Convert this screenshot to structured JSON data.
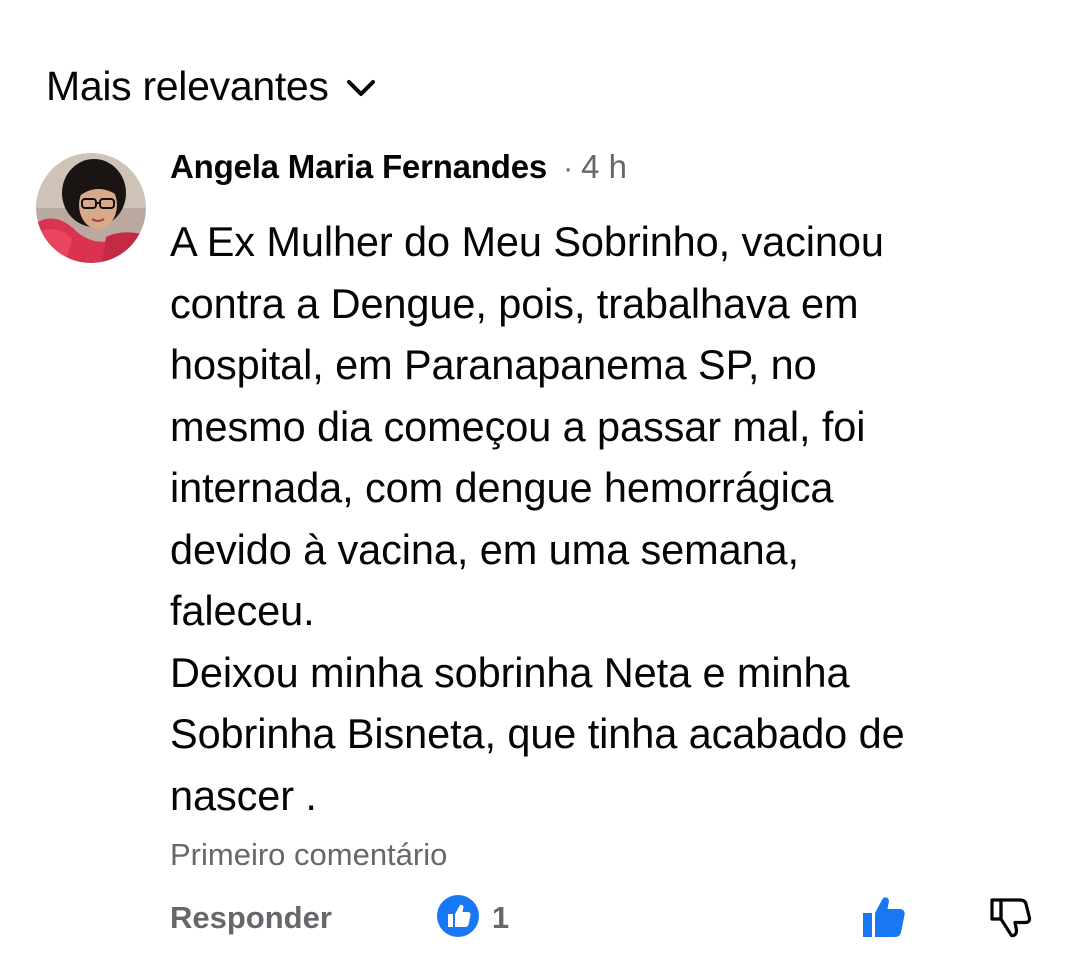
{
  "sort": {
    "label": "Mais relevantes",
    "icon": "chevron-down-icon"
  },
  "comment": {
    "author": "Angela Maria Fernandes",
    "separator": "·",
    "timestamp": "4 h",
    "text": "A Ex Mulher do Meu Sobrinho, vacinou\ncontra a Dengue, pois, trabalhava em\nhospital, em Paranapanema SP,  no\nmesmo dia começou a passar mal, foi\ninternada, com dengue hemorrágica\ndevido à vacina, em uma semana,\nfaleceu.\nDeixou minha sobrinha Neta e minha\nSobrinha Bisneta, que tinha acabado de\nnascer .",
    "label": "Primeiro comentário",
    "reply_label": "Responder",
    "reaction_count": "1",
    "reaction_icon": "like-reaction-icon"
  },
  "colors": {
    "text_primary": "#050505",
    "text_secondary": "#65676b",
    "accent_blue": "#1877f2"
  }
}
